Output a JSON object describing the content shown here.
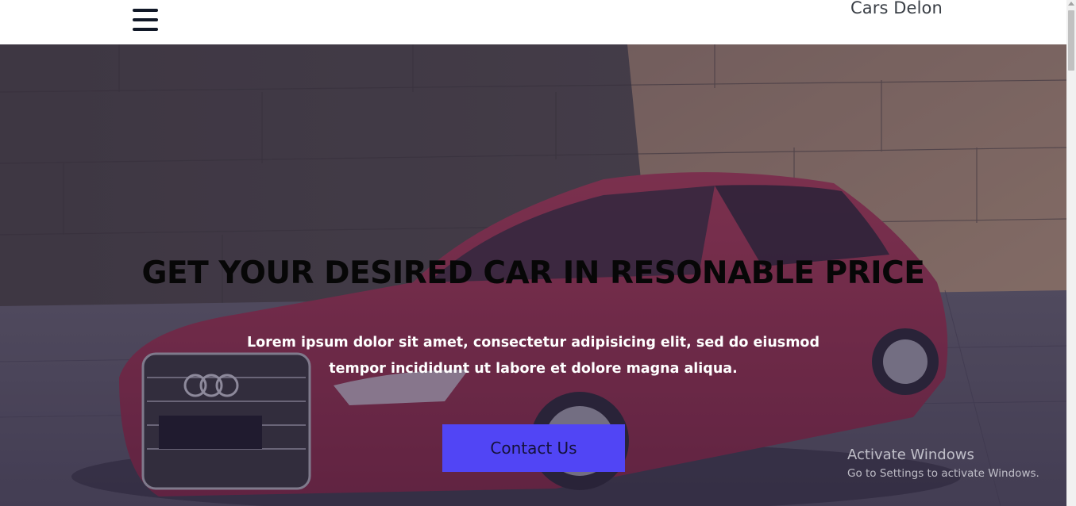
{
  "navbar": {
    "brand": "Cars Delon",
    "menu_icon": "hamburger-menu-icon"
  },
  "hero": {
    "headline": "GET YOUR DESIRED CAR IN RESONABLE PRICE",
    "lead": "Lorem ipsum dolor sit amet, consectetur adipisicing elit, sed do eiusmod tempor incididunt ut labore et dolore magna aliqua.",
    "cta_label": "Contact Us",
    "cta_color": "#5145f5",
    "background_image": "red sedan parked in front of a stone wall"
  },
  "watermark": {
    "title": "Activate Windows",
    "subtitle": "Go to Settings to activate Windows."
  },
  "colors": {
    "navbar_bg": "#ffffff",
    "headline": "#070707",
    "lead_text": "#ffffff",
    "button_text": "#15123a"
  }
}
